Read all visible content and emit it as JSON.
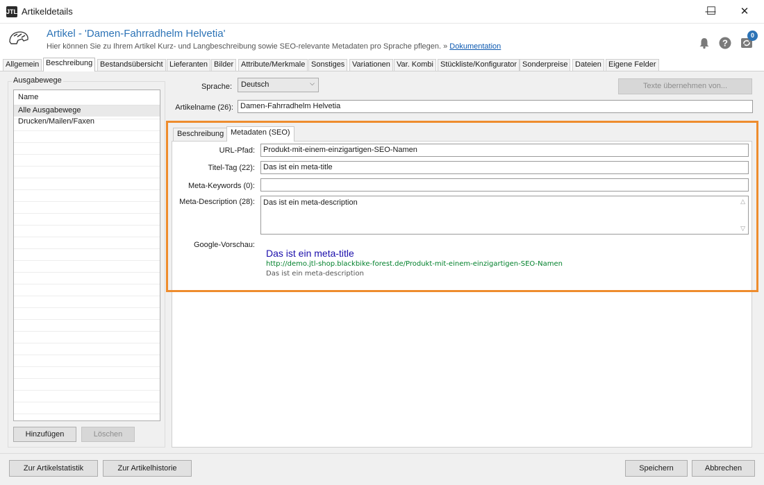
{
  "window": {
    "title": "Artikeldetails",
    "app_icon_text": "JTL",
    "minimize": "—",
    "maximize": "☐",
    "close": "✕"
  },
  "header": {
    "title": "Artikel - 'Damen-Fahrradhelm Helvetia'",
    "subtitle": "Hier können Sie zu Ihrem Artikel Kurz- und Langbeschreibung sowie SEO-relevante Metadaten pro Sprache pflegen. »",
    "doc_link": "Dokumentation",
    "badge_count": "0",
    "accent_color": "#2c73b6"
  },
  "tabs": [
    {
      "label": "Allgemein"
    },
    {
      "label": "Beschreibung"
    },
    {
      "label": "Bestandsübersicht"
    },
    {
      "label": "Lieferanten"
    },
    {
      "label": "Bilder"
    },
    {
      "label": "Attribute/Merkmale"
    },
    {
      "label": "Sonstiges"
    },
    {
      "label": "Variationen"
    },
    {
      "label": "Var. Kombi"
    },
    {
      "label": "Stückliste/Konfigurator"
    },
    {
      "label": "Sonderpreise"
    },
    {
      "label": "Dateien"
    },
    {
      "label": "Eigene Felder"
    }
  ],
  "active_tab": "Beschreibung",
  "ausgabewege": {
    "group_label": "Ausgabewege",
    "column_header": "Name",
    "items": [
      {
        "label": "Alle Ausgabewege"
      },
      {
        "label": "Drucken/Mailen/Faxen"
      }
    ],
    "add_button": "Hinzufügen",
    "delete_button": "Löschen"
  },
  "form": {
    "language_label": "Sprache:",
    "language_value": "Deutsch",
    "copy_texts_button": "Texte übernehmen von...",
    "name_label": "Artikelname (26):",
    "name_value": "Damen-Fahrradhelm Helvetia"
  },
  "inner_tabs": [
    {
      "label": "Beschreibung"
    },
    {
      "label": "Metadaten (SEO)"
    }
  ],
  "seo": {
    "url_label": "URL-Pfad:",
    "url_value": "Produkt-mit-einem-einzigartigen-SEO-Namen",
    "title_label": "Titel-Tag (22):",
    "title_value": "Das ist ein meta-title",
    "keywords_label": "Meta-Keywords (0):",
    "keywords_value": "",
    "description_label": "Meta-Description (28):",
    "description_value": "Das ist ein meta-description",
    "preview_label": "Google-Vorschau:",
    "preview_title": "Das ist ein meta-title",
    "preview_url": "http://demo.jtl-shop.blackbike-forest.de/Produkt-mit-einem-einzigartigen-SEO-Namen",
    "preview_desc": "Das ist ein meta-description",
    "highlight_color": "#ee8c2d"
  },
  "footer": {
    "stats_button": "Zur Artikelstatistik",
    "history_button": "Zur Artikelhistorie",
    "save_button": "Speichern",
    "cancel_button": "Abbrechen"
  }
}
